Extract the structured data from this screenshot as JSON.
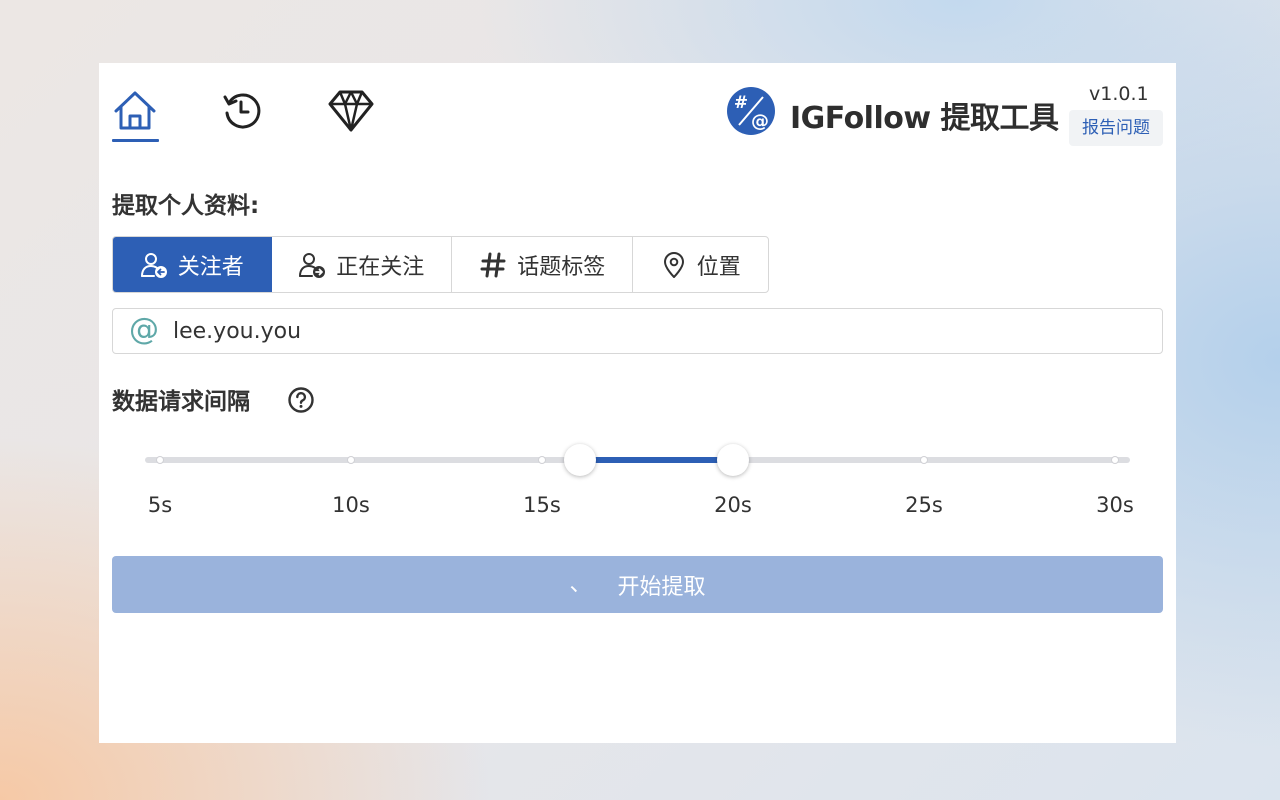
{
  "app": {
    "title": "IGFollow 提取工具",
    "version": "v1.0.1",
    "report_label": "报告问题",
    "logo_glyphs": {
      "top": "#",
      "bottom": "@"
    }
  },
  "nav": {
    "items": [
      {
        "icon": "home-icon",
        "active": true
      },
      {
        "icon": "history-icon",
        "active": false
      },
      {
        "icon": "diamond-icon",
        "active": false
      }
    ]
  },
  "extract": {
    "section_title": "提取个人资料:",
    "tabs": [
      {
        "label": "关注者",
        "icon": "followers-icon",
        "active": true
      },
      {
        "label": "正在关注",
        "icon": "following-icon",
        "active": false
      },
      {
        "label": "话题标签",
        "icon": "hashtag-icon",
        "active": false
      },
      {
        "label": "位置",
        "icon": "location-pin-icon",
        "active": false
      }
    ],
    "username_prefix": "@",
    "username_value": "lee.you.you"
  },
  "interval": {
    "title": "数据请求间隔",
    "help_icon": "question-circle-icon",
    "marks": [
      "5s",
      "10s",
      "15s",
      "20s",
      "25s",
      "30s"
    ],
    "min": 5,
    "max": 30,
    "range_low": 16,
    "range_high": 20
  },
  "start": {
    "spinner": "、",
    "label": "开始提取"
  },
  "colors": {
    "accent": "#2d5fb5",
    "button_disabled": "#9ab3dc",
    "at_sign": "#5fa8a8"
  }
}
